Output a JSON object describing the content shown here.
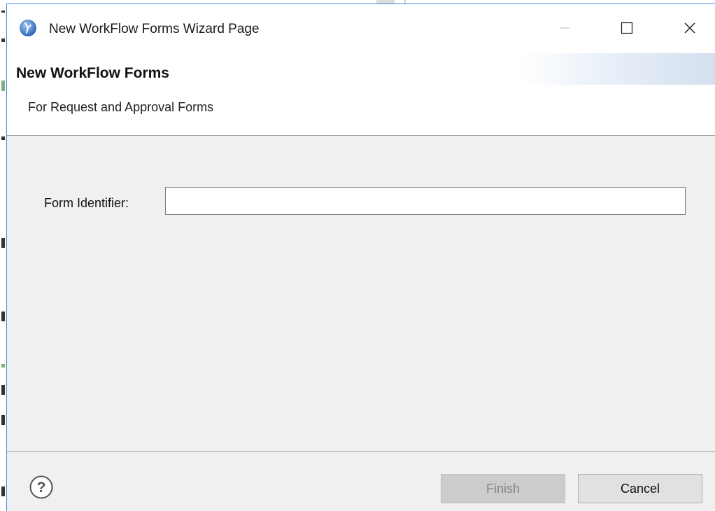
{
  "window": {
    "title": "New WorkFlow Forms Wizard Page",
    "icon": "eclipse-app-icon"
  },
  "header": {
    "title": "New WorkFlow Forms",
    "subtitle": "For Request and Approval Forms"
  },
  "form": {
    "identifier_label": "Form Identifier:",
    "identifier_value": "",
    "identifier_placeholder": ""
  },
  "footer": {
    "help_icon": "help-icon",
    "finish_label": "Finish",
    "cancel_label": "Cancel",
    "finish_enabled": false
  },
  "colors": {
    "dialog_bg": "#f0f0f0",
    "accent_border": "#3c8ee6",
    "disabled_button_bg": "#cccccc",
    "disabled_text": "#838383"
  }
}
